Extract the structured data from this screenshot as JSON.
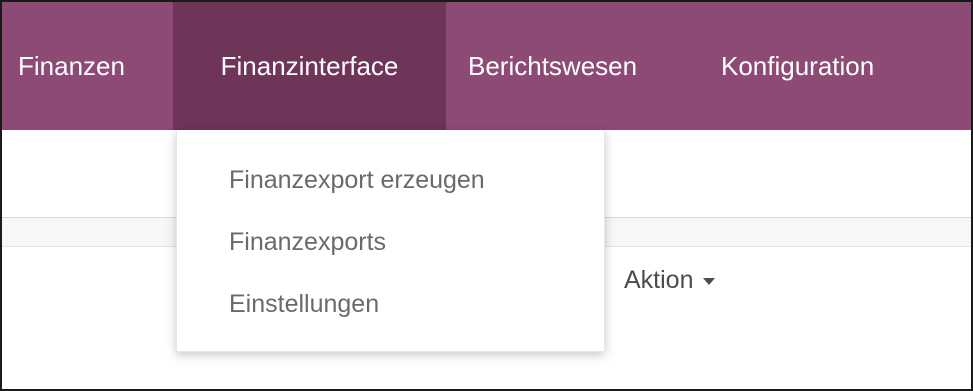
{
  "navbar": {
    "items": [
      {
        "label": "Finanzen"
      },
      {
        "label": "Finanzinterface"
      },
      {
        "label": "Berichtswesen"
      },
      {
        "label": "Konfiguration"
      }
    ],
    "active_index": 1,
    "colors": {
      "background": "#8c4a75",
      "active_background": "#6e3558",
      "text": "#ffffff"
    }
  },
  "dropdown": {
    "items": [
      {
        "label": "Finanzexport erzeugen"
      },
      {
        "label": "Finanzexports"
      },
      {
        "label": "Einstellungen"
      }
    ]
  },
  "toolbar": {
    "action_label": "Aktion"
  }
}
